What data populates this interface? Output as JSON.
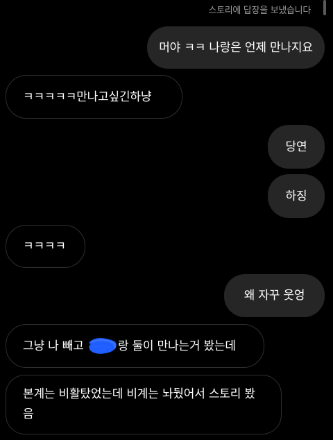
{
  "header": {
    "status": "스토리에 답장을 보냈습니다"
  },
  "colors": {
    "background": "#000000",
    "outgoing_bubble": "#262626",
    "incoming_border": "#2f2f2f",
    "redaction": "#1f5eff"
  },
  "messages": [
    {
      "direction": "outgoing",
      "text": "머야 ㅋㅋ 나랑은 언제 만나지요"
    },
    {
      "direction": "incoming",
      "text": "ㅋㅋㅋㅋㅋ만나고싶긴하냥"
    },
    {
      "direction": "outgoing",
      "text": "당연"
    },
    {
      "direction": "outgoing",
      "text": "하징"
    },
    {
      "direction": "incoming",
      "text": "ㅋㅋㅋㅋ"
    },
    {
      "direction": "outgoing",
      "text": "왜 자꾸 웃엉"
    },
    {
      "direction": "incoming",
      "text_before": "그냥 나 빼고 ",
      "redacted": "redacted-name",
      "text_after": "랑 둘이 만나는거 봤는데"
    },
    {
      "direction": "incoming",
      "text": "본계는 비활탔었는데 비계는 놔뒀어서 스토리 봤음"
    }
  ]
}
